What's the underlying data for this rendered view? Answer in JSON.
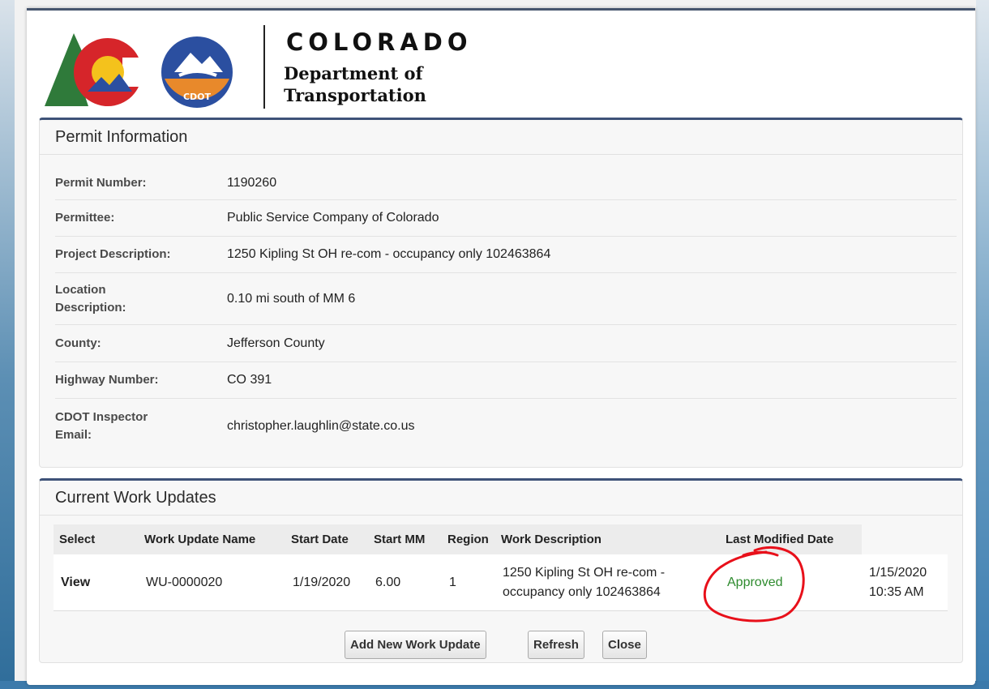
{
  "branding": {
    "state_word": "COLORADO",
    "dept_line1": "Department of",
    "dept_line2": "Transportation",
    "badge_text": "CDOT"
  },
  "permit_panel": {
    "title": "Permit Information",
    "fields": [
      {
        "label": "Permit Number:",
        "value": "1190260"
      },
      {
        "label": "Permittee:",
        "value": "Public Service Company of Colorado"
      },
      {
        "label": "Project Description:",
        "value": "1250 Kipling St OH re-com - occupancy only 102463864"
      },
      {
        "label_line1": "Location",
        "label_line2": "Description:",
        "value": "0.10 mi south of MM 6"
      },
      {
        "label": "County:",
        "value": "Jefferson County"
      },
      {
        "label": "Highway Number:",
        "value": "CO 391"
      },
      {
        "label_line1": "CDOT Inspector",
        "label_line2": "Email:",
        "value": "christopher.laughlin@state.co.us"
      }
    ]
  },
  "work_panel": {
    "title": "Current Work Updates",
    "columns": [
      "Select",
      "Work Update Name",
      "Start Date",
      "Start MM",
      "Region",
      "Work Description",
      "Last Modified Date"
    ],
    "rows": [
      {
        "select": "View",
        "name": "WU-0000020",
        "start_date": "1/19/2020",
        "start_mm": "6.00",
        "region": "1",
        "desc_line1": "1250 Kipling St OH re-com -",
        "desc_line2": "occupancy only 102463864",
        "status": "Approved",
        "modified_line1": "1/15/2020",
        "modified_line2": "10:35 AM"
      }
    ],
    "buttons": {
      "add": "Add New Work Update",
      "refresh": "Refresh",
      "close": "Close"
    }
  },
  "colors": {
    "panel_accent": "#3e5278",
    "status_approved": "#2e8b2e",
    "annotation": "#e8101a"
  }
}
